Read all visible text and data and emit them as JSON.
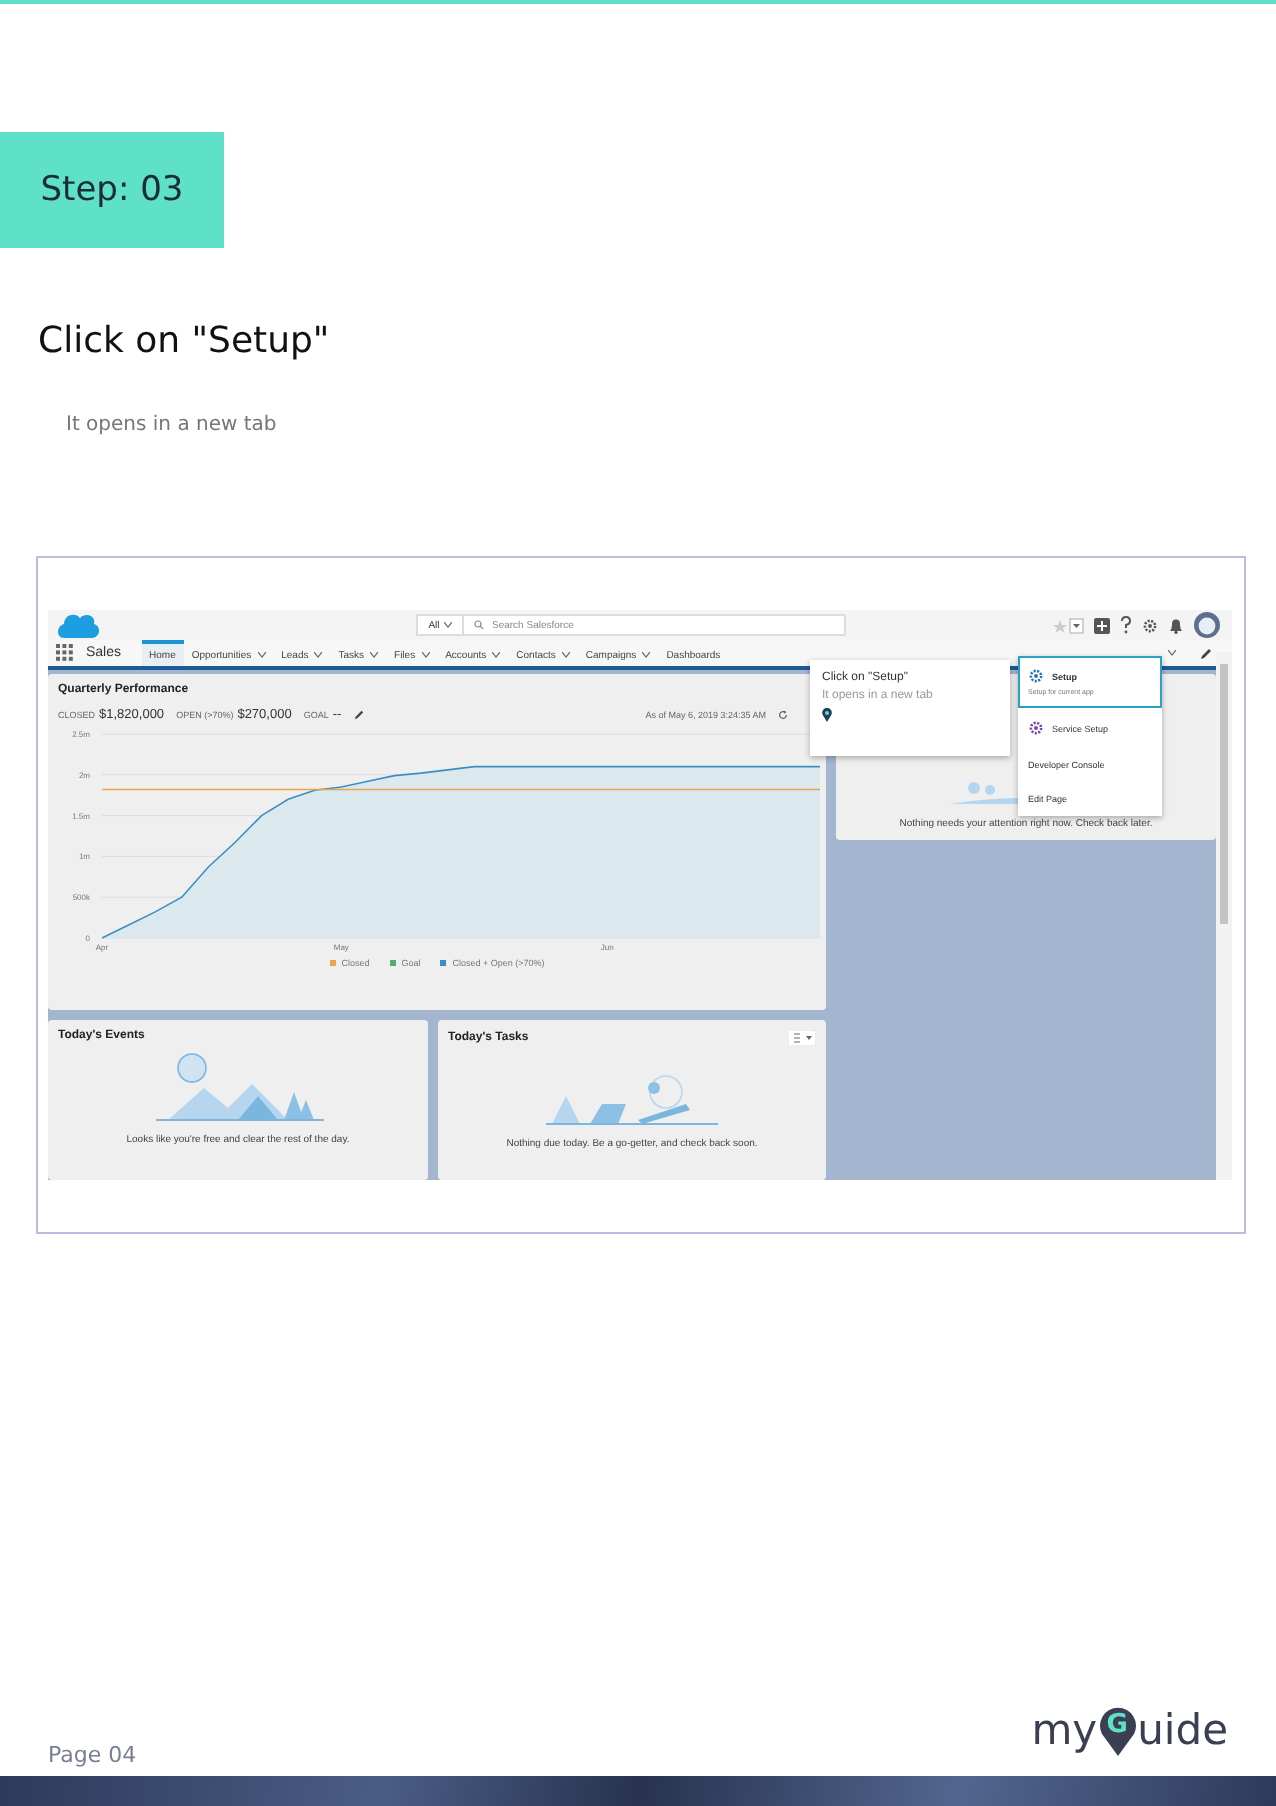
{
  "step_badge": "Step: 03",
  "heading": "Click on \"Setup\"",
  "subheading": "It opens in a new tab",
  "screenshot": {
    "app_name": "Sales",
    "search": {
      "scope": "All",
      "placeholder": "Search Salesforce"
    },
    "nav": [
      {
        "label": "Home",
        "selected": true,
        "menu": false
      },
      {
        "label": "Opportunities",
        "selected": false,
        "menu": true
      },
      {
        "label": "Leads",
        "selected": false,
        "menu": true
      },
      {
        "label": "Tasks",
        "selected": false,
        "menu": true
      },
      {
        "label": "Files",
        "selected": false,
        "menu": true
      },
      {
        "label": "Accounts",
        "selected": false,
        "menu": true
      },
      {
        "label": "Contacts",
        "selected": false,
        "menu": true
      },
      {
        "label": "Campaigns",
        "selected": false,
        "menu": true
      },
      {
        "label": "Dashboards",
        "selected": false,
        "menu": false
      }
    ],
    "performance": {
      "title": "Quarterly Performance",
      "stats": [
        {
          "label": "CLOSED",
          "value": "$1,820,000"
        },
        {
          "label": "OPEN (>70%)",
          "value": "$270,000"
        },
        {
          "label": "GOAL",
          "value": "--"
        }
      ],
      "timestamp": "As of May 6, 2019 3:24:35 AM",
      "chart_data": {
        "type": "line",
        "grid": true,
        "categories": [
          "Apr",
          null,
          null,
          null,
          null,
          null,
          null,
          null,
          null,
          "May",
          null,
          null,
          null,
          null,
          null,
          null,
          null,
          null,
          null,
          "Jun",
          null,
          null,
          null,
          null,
          null,
          null,
          null,
          null
        ],
        "ylim": [
          0,
          2500000
        ],
        "yticks": [
          {
            "value": 0,
            "label": "0"
          },
          {
            "value": 500000,
            "label": "500k"
          },
          {
            "value": 1000000,
            "label": "1m"
          },
          {
            "value": 1500000,
            "label": "1.5m"
          },
          {
            "value": 2000000,
            "label": "2m"
          },
          {
            "value": 2500000,
            "label": "2.5m"
          }
        ],
        "series": [
          {
            "name": "Closed",
            "color": "#e8a54b",
            "values": [
              1820000,
              1820000,
              1820000,
              1820000,
              1820000,
              1820000,
              1820000,
              1820000,
              1820000,
              1820000,
              1820000,
              1820000,
              1820000,
              1820000,
              1820000,
              1820000,
              1820000,
              1820000,
              1820000,
              1820000,
              1820000,
              1820000,
              1820000,
              1820000,
              1820000,
              1820000,
              1820000,
              1820000
            ]
          },
          {
            "name": "Goal",
            "color": "#4bb072",
            "values": [
              null,
              null,
              null,
              null,
              null,
              null,
              null,
              null,
              null,
              null,
              null,
              null,
              null,
              null,
              null,
              null,
              null,
              null,
              null,
              null,
              null,
              null,
              null,
              null,
              null,
              null,
              null,
              null
            ]
          },
          {
            "name": "Closed + Open (>70%)",
            "color": "#3a8fc2",
            "values": [
              0,
              160000,
              320000,
              500000,
              870000,
              1170000,
              1500000,
              1700000,
              1810000,
              1850000,
              1920000,
              1990000,
              2020000,
              2060000,
              2100000,
              2100000,
              2100000,
              2100000,
              2100000,
              2100000,
              2100000,
              2100000,
              2100000,
              2100000,
              2100000,
              2100000,
              2100000,
              2100000
            ]
          }
        ]
      }
    },
    "assistant": {
      "message": "Nothing needs your attention right now. Check back later."
    },
    "events": {
      "title": "Today's Events",
      "message": "Looks like you're free and clear the rest of the day."
    },
    "tasks": {
      "title": "Today's Tasks",
      "message": "Nothing due today. Be a go-getter, and check back soon."
    },
    "setup_menu": [
      {
        "label": "Setup",
        "subtitle": "Setup for current app",
        "selected": true,
        "color": "#2a6fb0"
      },
      {
        "label": "Service Setup",
        "selected": false,
        "color": "#7b3fb8"
      },
      {
        "label": "Developer Console",
        "selected": false
      },
      {
        "label": "Edit Page",
        "selected": false
      }
    ],
    "guide_tooltip": {
      "title": "Click on \"Setup\"",
      "text": "It opens in a new tab"
    }
  },
  "footer": {
    "page": "Page 04",
    "logo": {
      "before": "my",
      "pin_letter": "G",
      "after": "uide"
    }
  }
}
